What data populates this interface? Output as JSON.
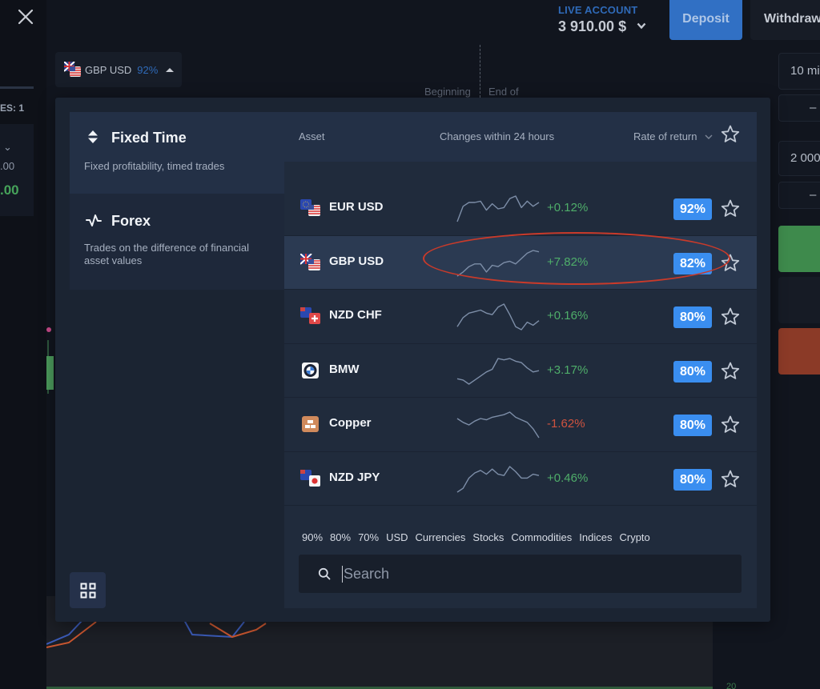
{
  "header": {
    "account_type": "LIVE ACCOUNT",
    "balance": "3 910.00 $",
    "deposit_label": "Deposit",
    "withdraw_label": "Withdraw"
  },
  "left_panel_peek": {
    "trades_label": "ES: 1",
    "value1": ".00",
    "value2": ".00"
  },
  "asset_selector": {
    "asset": "GBP USD",
    "rate": "92%"
  },
  "chart": {
    "beginning_label": "Beginning",
    "end_label": "End of",
    "axis_value": "20"
  },
  "right_panel": {
    "duration": "10 mi",
    "amount": "2 000",
    "minus1": "–",
    "minus2": "–"
  },
  "modal": {
    "modes": [
      {
        "title": "Fixed Time",
        "description": "Fixed profitability, timed trades",
        "icon": "up-down-icon",
        "selected": true
      },
      {
        "title": "Forex",
        "description": "Trades on the difference of financial asset values",
        "icon": "pulse-icon",
        "selected": false
      }
    ],
    "columns": {
      "asset": "Asset",
      "changes": "Changes within 24 hours",
      "rate": "Rate of return"
    },
    "assets": [
      {
        "name": "EUR USD",
        "change": "+0.12%",
        "direction": "pos",
        "rate": "92%",
        "icon": "eur-usd-flag",
        "selected": false,
        "spark": [
          2,
          14,
          17,
          17,
          18,
          11,
          16,
          12,
          13,
          20,
          22,
          13,
          18,
          14,
          17
        ]
      },
      {
        "name": "GBP USD",
        "change": "+7.82%",
        "direction": "pos",
        "rate": "82%",
        "icon": "gbp-usd-flag",
        "selected": true,
        "spark": [
          2,
          5,
          9,
          11,
          11,
          5,
          10,
          9,
          12,
          13,
          11,
          15,
          19,
          21,
          20
        ]
      },
      {
        "name": "NZD CHF",
        "change": "+0.16%",
        "direction": "pos",
        "rate": "80%",
        "icon": "nzd-chf-flag",
        "selected": false,
        "spark": [
          5,
          11,
          14,
          15,
          16,
          14,
          13,
          18,
          20,
          13,
          5,
          3,
          8,
          6,
          9
        ]
      },
      {
        "name": "BMW",
        "change": "+3.17%",
        "direction": "pos",
        "rate": "80%",
        "icon": "bmw-logo",
        "selected": false,
        "spark": [
          4,
          3,
          0,
          3,
          6,
          9,
          11,
          19,
          18,
          19,
          17,
          16,
          12,
          9,
          10
        ]
      },
      {
        "name": "Copper",
        "change": "-1.62%",
        "direction": "neg",
        "rate": "80%",
        "icon": "copper-icon",
        "selected": false,
        "spark": [
          15,
          12,
          10,
          13,
          15,
          14,
          16,
          17,
          18,
          20,
          16,
          14,
          12,
          7,
          0
        ]
      },
      {
        "name": "NZD JPY",
        "change": "+0.46%",
        "direction": "pos",
        "rate": "80%",
        "icon": "nzd-jpy-flag",
        "selected": false,
        "spark": [
          0,
          3,
          11,
          15,
          17,
          14,
          18,
          14,
          13,
          20,
          16,
          11,
          11,
          14,
          13
        ]
      }
    ],
    "filters": [
      "90%",
      "80%",
      "70%",
      "USD",
      "Currencies",
      "Stocks",
      "Commodities",
      "Indices",
      "Crypto"
    ],
    "search": {
      "placeholder": "Search",
      "value": ""
    }
  },
  "colors": {
    "accent_blue": "#3a8ef0",
    "positive": "#4fae6a",
    "negative": "#d0533f",
    "annotation_red": "#c93a2a"
  }
}
